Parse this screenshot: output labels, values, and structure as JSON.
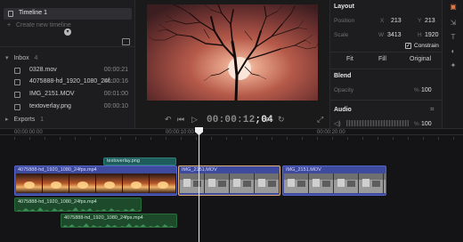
{
  "project": {
    "timeline_name": "Timeline 1",
    "create_label": "Create new timeline"
  },
  "inbox": {
    "label": "Inbox",
    "count": "4",
    "files": [
      {
        "name": "0328.mov",
        "duration": "00:00:21"
      },
      {
        "name": "4075888-hd_1920_1080_24f...",
        "duration": "00:00:16"
      },
      {
        "name": "IMG_2151.MOV",
        "duration": "00:01:00"
      },
      {
        "name": "textoverlay.png",
        "duration": "00:00:10"
      }
    ]
  },
  "exports": {
    "label": "Exports",
    "count": "1"
  },
  "preview": {
    "timecode_main": "00:00:12",
    "timecode_frames": ";04"
  },
  "inspector": {
    "layout_title": "Layout",
    "position_label": "Position",
    "x_label": "X",
    "x_value": "213",
    "y_label": "Y",
    "y_value": "213",
    "scale_label": "Scale",
    "w_label": "W",
    "w_value": "3413",
    "h_label": "H",
    "h_value": "1920",
    "constrain_label": "Constrain",
    "constrain_checked": true,
    "fit_tabs": [
      "Fit",
      "Fill",
      "Original"
    ],
    "blend_title": "Blend",
    "opacity_label": "Opacity",
    "opacity_unit": "%",
    "opacity_value": "100",
    "audio_title": "Audio",
    "audio_unit": "%",
    "audio_value": "100"
  },
  "timeline": {
    "ruler_labels": [
      "00:00:00:00",
      "00:00:10:00",
      "00:00:20:00"
    ],
    "clips": {
      "text_overlay": "textoverlay.png",
      "video_a": "4075888-hd_1920_1080_24fps.mp4",
      "video_b": "IMG_2151.MOV",
      "video_c": "IMG_2151.MOV",
      "audio_a": "4075888-hd_1920_1080_24fps.mp4",
      "audio_b": "4075888-hd_1920_1080_24fps.mp4"
    }
  },
  "colors": {
    "accent": "#e0b07a",
    "video_clip": "#3d4a9e",
    "audio_clip": "#1c4a2a",
    "text_clip": "#1d5c5a"
  }
}
